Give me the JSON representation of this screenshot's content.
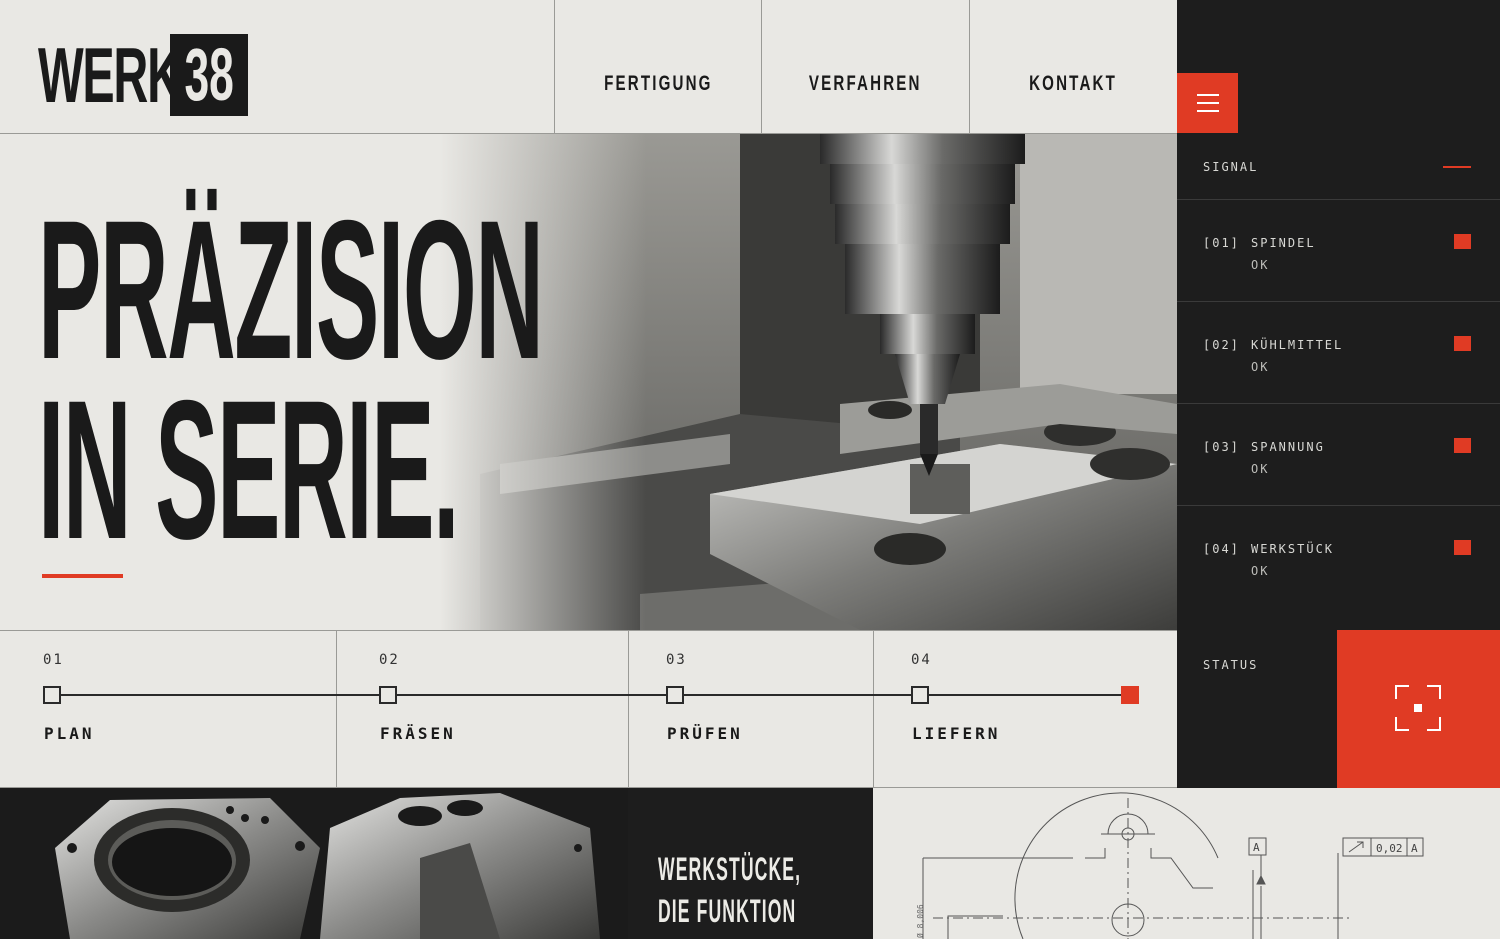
{
  "brand": {
    "word": "WERK",
    "number": "38"
  },
  "nav": [
    {
      "label": "FERTIGUNG"
    },
    {
      "label": "VERFAHREN"
    },
    {
      "label": "KONTAKT"
    }
  ],
  "hero": {
    "line1": "PRÄZISION",
    "line2": "IN SERIE."
  },
  "signal": {
    "title": "SIGNAL",
    "items": [
      {
        "num": "[01]",
        "name": "SPINDEL",
        "status": "OK"
      },
      {
        "num": "[02]",
        "name": "KÜHLMITTEL",
        "status": "OK"
      },
      {
        "num": "[03]",
        "name": "SPANNUNG",
        "status": "OK"
      },
      {
        "num": "[04]",
        "name": "WERKSTÜCK",
        "status": "OK"
      }
    ]
  },
  "process": {
    "steps": [
      {
        "num": "01",
        "label": "PLAN"
      },
      {
        "num": "02",
        "label": "FRÄSEN"
      },
      {
        "num": "03",
        "label": "PRÜFEN"
      },
      {
        "num": "04",
        "label": "LIEFERN"
      }
    ]
  },
  "status": {
    "title": "STATUS"
  },
  "parts": {
    "line1": "WERKSTÜCKE,",
    "line2": "DIE FUNKTION"
  },
  "drawing": {
    "datum": "A",
    "tolerance": "0,02",
    "ref": "A",
    "dim": "Ø 8,006"
  },
  "colors": {
    "accent": "#e03b24",
    "dark": "#1d1d1d",
    "paper": "#e9e8e4"
  }
}
